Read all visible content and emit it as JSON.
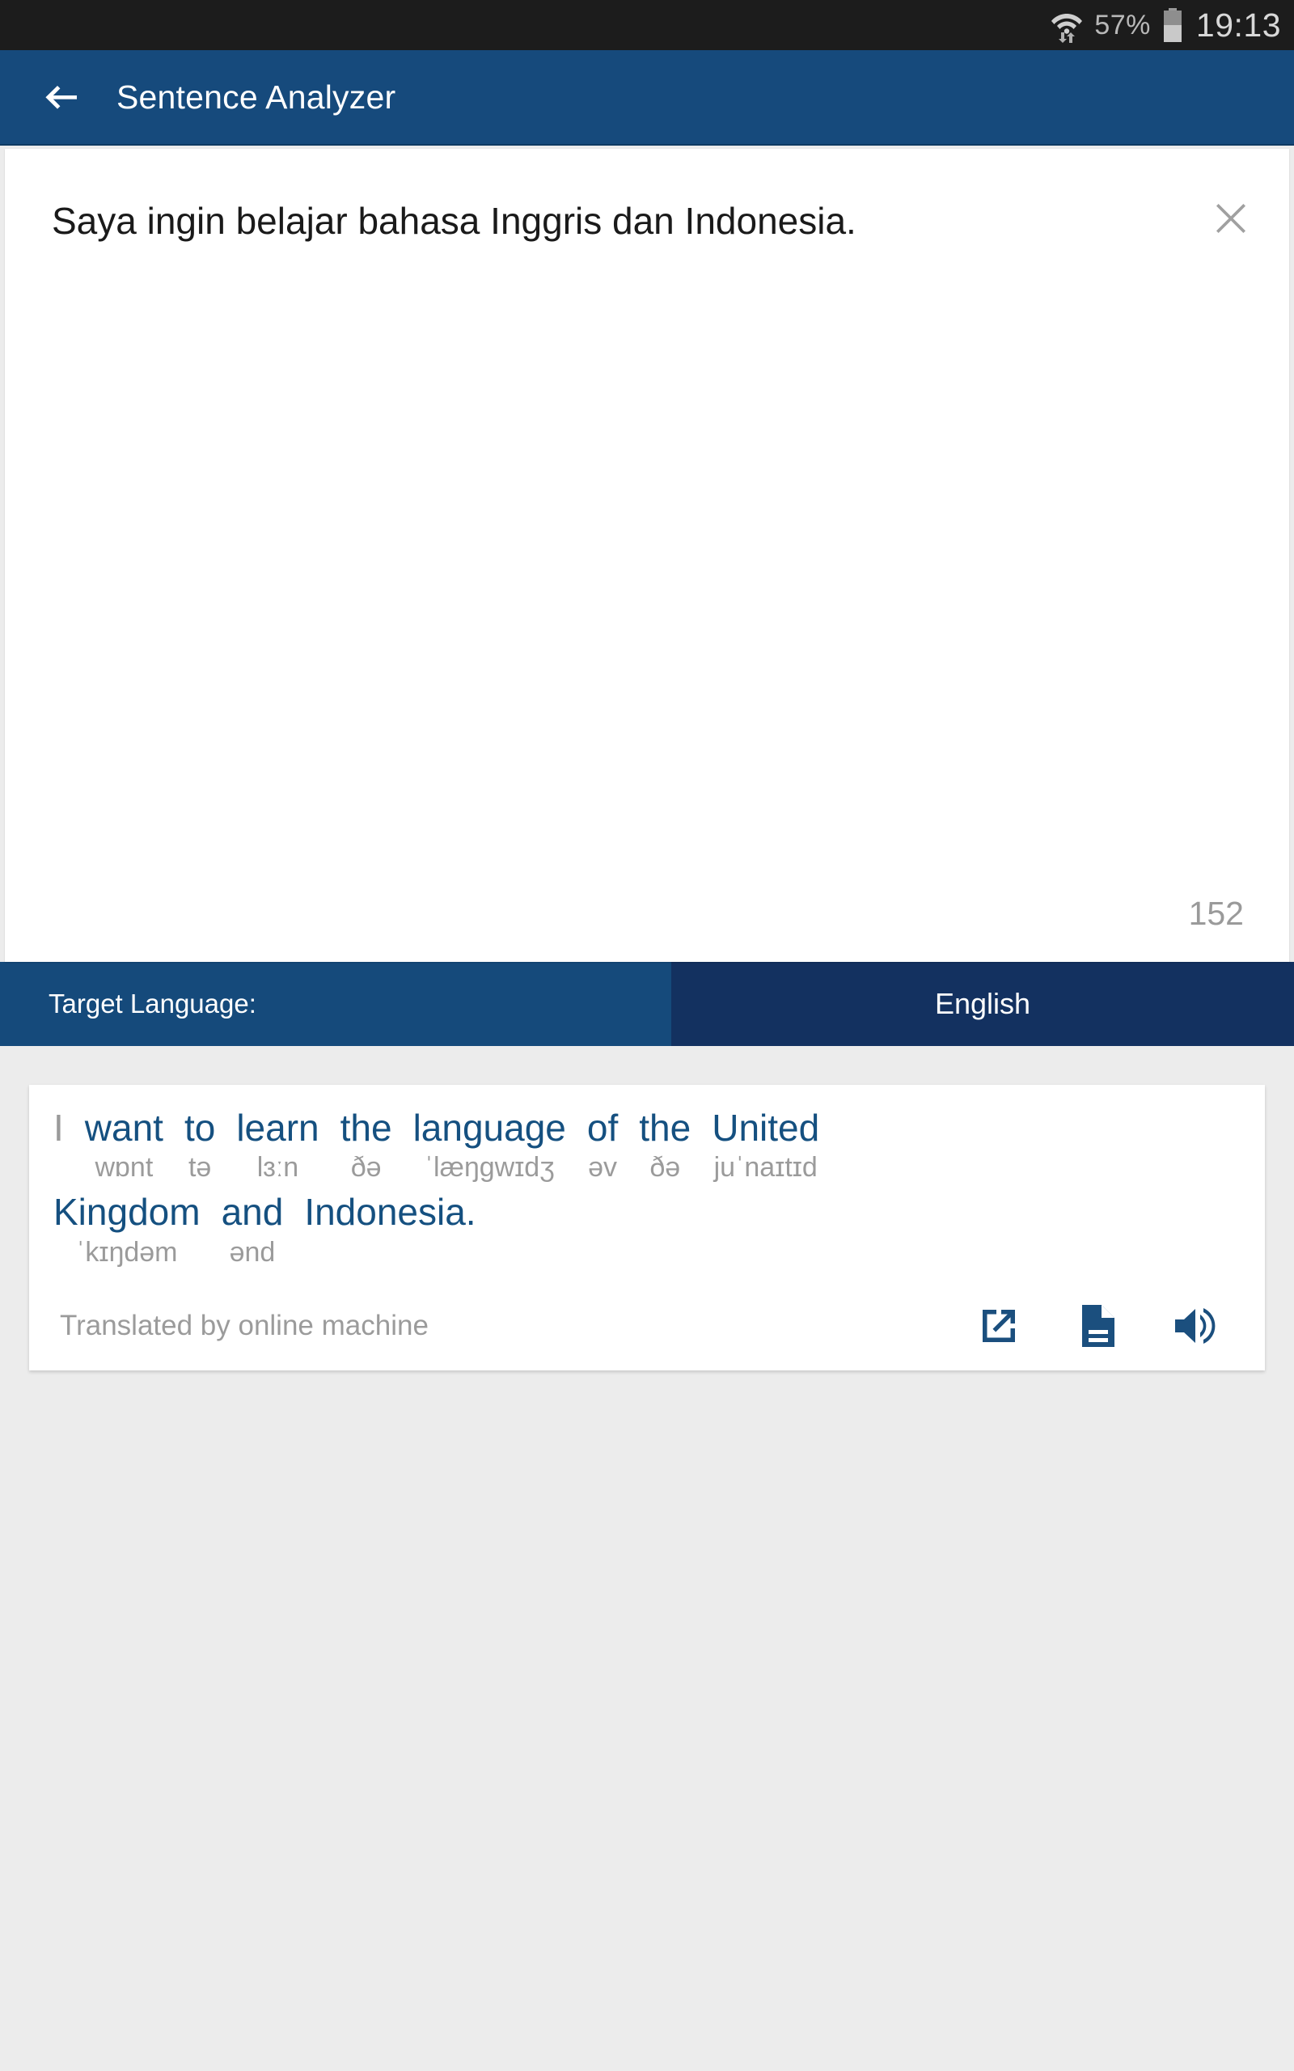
{
  "statusbar": {
    "wifi_icon": "wifi-with-data-arrows-icon",
    "battery_percent": "57%",
    "battery_icon": "battery-icon",
    "clock": "19:13"
  },
  "appbar": {
    "back_icon": "back-arrow-icon",
    "title": "Sentence Analyzer"
  },
  "input_area": {
    "sentence": "Saya ingin belajar bahasa Inggris dan Indonesia.",
    "clear_icon": "close-icon",
    "char_count": "152"
  },
  "target_language": {
    "label": "Target Language:",
    "value": "English"
  },
  "result": {
    "lines": [
      [
        {
          "word": "I",
          "ipa": "",
          "plain": true
        },
        {
          "word": "want",
          "ipa": "wɒnt"
        },
        {
          "word": "to",
          "ipa": "tə"
        },
        {
          "word": "learn",
          "ipa": "lɜːn"
        },
        {
          "word": "the",
          "ipa": "ðə"
        },
        {
          "word": "language",
          "ipa": "ˈlæŋgwɪdʒ"
        },
        {
          "word": "of",
          "ipa": "əv"
        },
        {
          "word": "the",
          "ipa": "ðə"
        },
        {
          "word": "United",
          "ipa": "juˈnaɪtɪd"
        }
      ],
      [
        {
          "word": "Kingdom",
          "ipa": "ˈkɪŋdəm"
        },
        {
          "word": "and",
          "ipa": "ənd"
        },
        {
          "word": "Indonesia.",
          "ipa": ""
        }
      ]
    ],
    "footer_note": "Translated by online machine",
    "icons": [
      {
        "name": "open-in-new-icon"
      },
      {
        "name": "document-icon"
      },
      {
        "name": "volume-up-icon"
      }
    ]
  },
  "colors": {
    "appbar": "#164a7c",
    "target_left": "#154a7b",
    "target_right": "#133160",
    "accent_text": "#155080",
    "muted_text": "#9b9b9b",
    "page_bg": "#ececec",
    "statusbar": "#1c1c1c"
  }
}
